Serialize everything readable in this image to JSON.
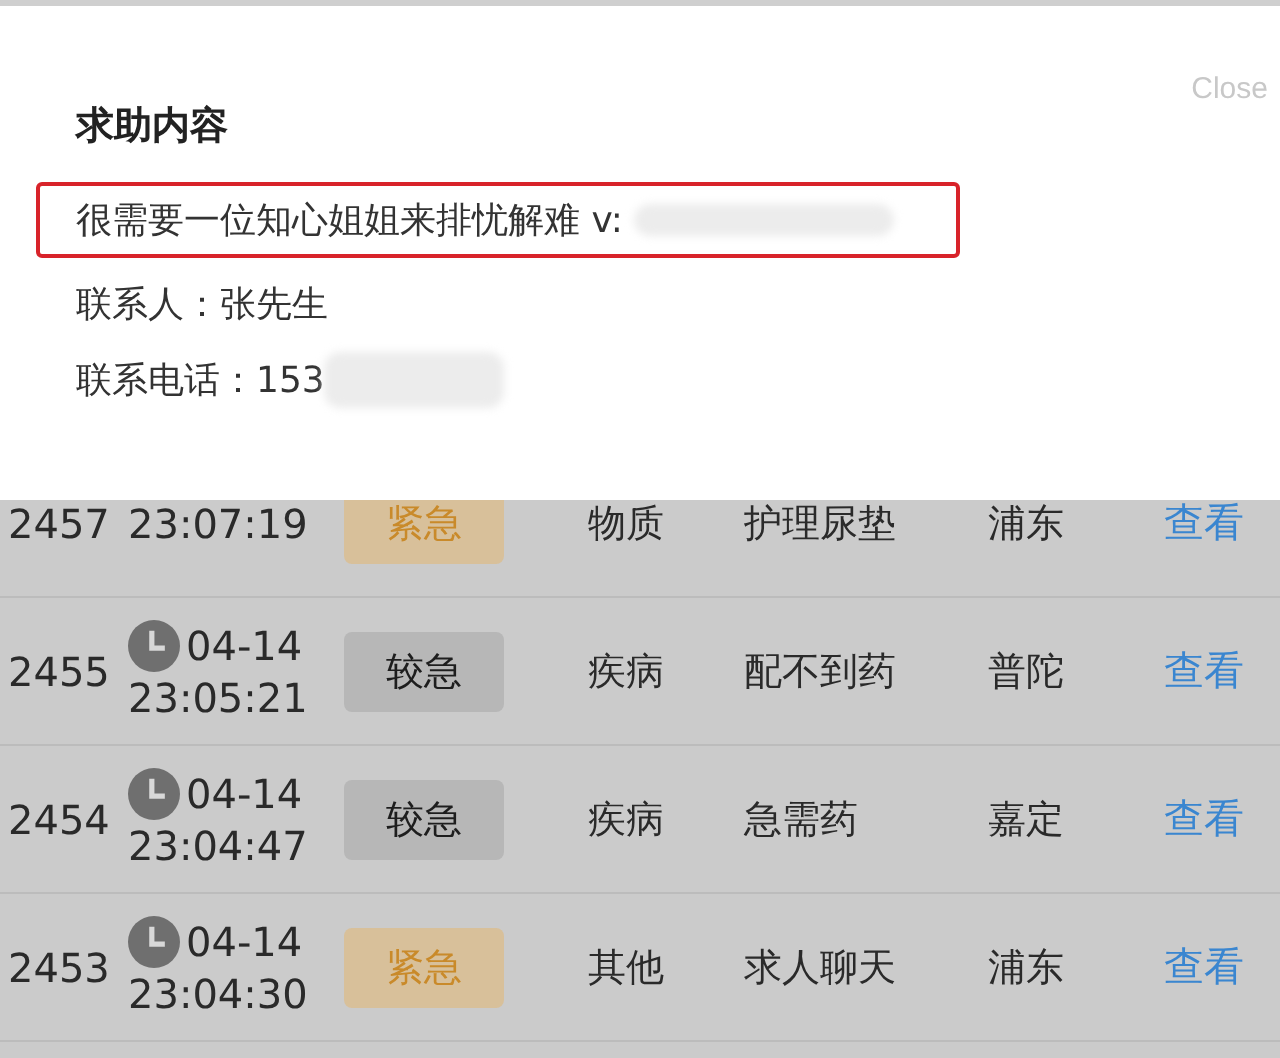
{
  "dialog": {
    "close": "Close",
    "title": "求助内容",
    "content": {
      "text": "很需要一位知心姐姐来排忧解难 v:",
      "highlighted": true,
      "redacted": true
    },
    "contact": {
      "text": "联系人：张先生"
    },
    "phone": {
      "text": "联系电话：153",
      "redacted": true
    }
  },
  "rows": [
    {
      "id": "2457",
      "time": "23:07:19",
      "urgency": "紧急",
      "kind": "urgent",
      "category": "物质",
      "need": "护理尿垫",
      "district": "浦东",
      "action": "查看"
    },
    {
      "id": "2455",
      "date": "04-14",
      "time": "23:05:21",
      "urgency": "较急",
      "kind": "moderate",
      "category": "疾病",
      "need": "配不到药",
      "district": "普陀",
      "action": "查看"
    },
    {
      "id": "2454",
      "date": "04-14",
      "time": "23:04:47",
      "urgency": "较急",
      "kind": "moderate",
      "category": "疾病",
      "need": "急需药",
      "district": "嘉定",
      "action": "查看"
    },
    {
      "id": "2453",
      "date": "04-14",
      "time": "23:04:30",
      "urgency": "紧急",
      "kind": "urgent",
      "category": "其他",
      "need": "求人聊天",
      "district": "浦东",
      "action": "查看"
    }
  ]
}
